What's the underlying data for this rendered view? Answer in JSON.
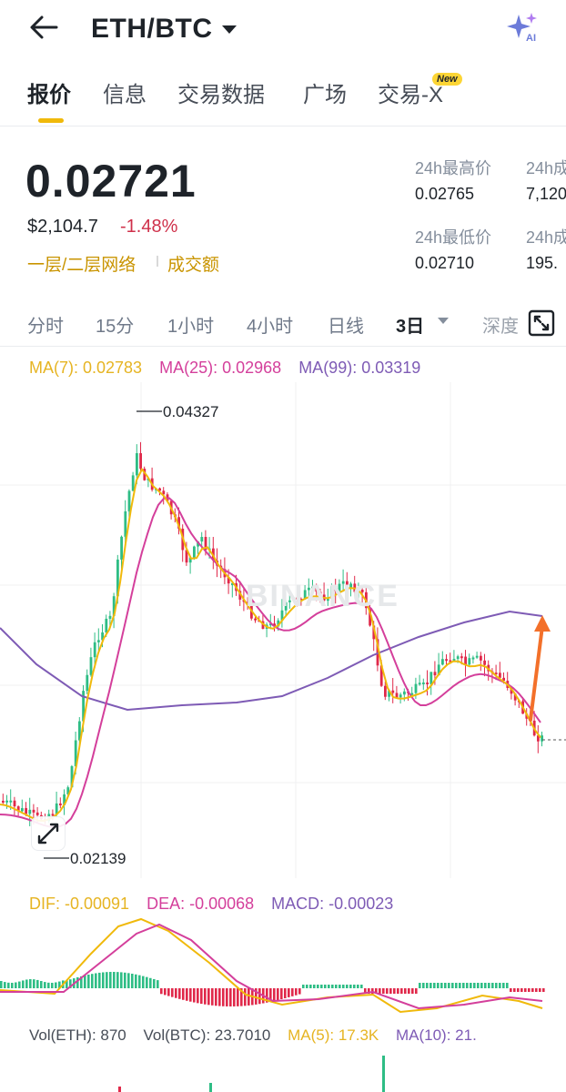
{
  "header": {
    "pair": "ETH/BTC"
  },
  "tabs": [
    {
      "label": "报价"
    },
    {
      "label": "信息"
    },
    {
      "label": "交易数据"
    },
    {
      "label": "广场"
    },
    {
      "label": "交易-X"
    }
  ],
  "new_badge": "New",
  "ticker": {
    "price": "0.02721",
    "usd_value": "$2,104.7",
    "change": "-1.48%",
    "network_label": "一层/二层网络",
    "volume_label": "成交额",
    "high_label": "24h最高价",
    "high_value": "0.02765",
    "low_label": "24h最低价",
    "low_value": "0.02710",
    "vol_label_1": "24h成",
    "vol_value_1": "7,120",
    "vol_label_2": "24h成",
    "vol_value_2": "195."
  },
  "intervals": [
    {
      "label": "分时"
    },
    {
      "label": "15分"
    },
    {
      "label": "1小时"
    },
    {
      "label": "4小时"
    },
    {
      "label": "日线"
    },
    {
      "label": "3日"
    },
    {
      "label": "深度"
    }
  ],
  "indicators": {
    "ma7": "MA(7): 0.02783",
    "ma25": "MA(25): 0.02968",
    "ma99": "MA(99): 0.03319",
    "dif": "DIF: -0.00091",
    "dea": "DEA: -0.00068",
    "macd": "MACD: -0.00023",
    "vol_eth": "Vol(ETH): 870",
    "vol_btc": "Vol(BTC): 23.7010",
    "vol_ma5": "MA(5): 17.3K",
    "vol_ma10": "MA(10): 21."
  },
  "chart_labels": {
    "high": "0.04327",
    "low": "0.02139"
  },
  "watermark": "BINANCE",
  "colors": {
    "up": "#2ebd85",
    "down": "#e0294a",
    "ma7": "#f0b90b",
    "ma25": "#d43f9b",
    "ma99": "#7e5bb5",
    "accent": "#f0b90b",
    "arrow": "#f3702a"
  }
}
